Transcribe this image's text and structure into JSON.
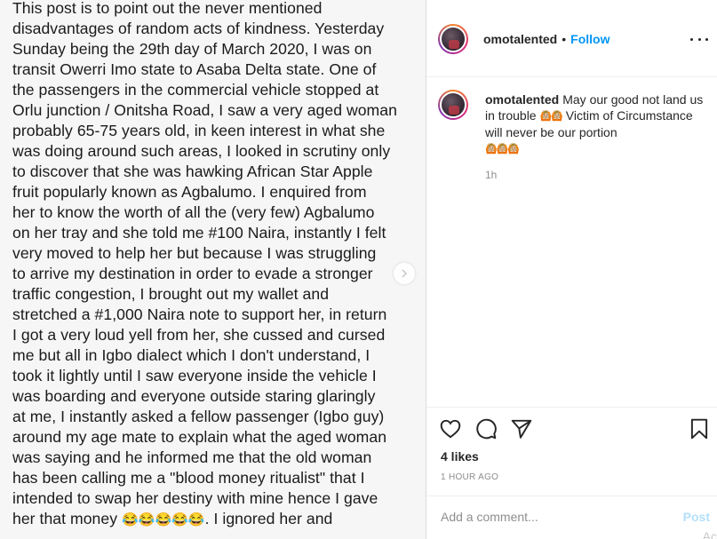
{
  "post": {
    "text_lines": [
      "This post is to point out the never mentioned",
      "disadvantages of random acts of kindness. Yesterday",
      "Sunday being the 29th day of March 2020, I was on",
      "transit Owerri Imo state to Asaba Delta state. One of",
      "the passengers in the commercial vehicle stopped at",
      "Orlu junction / Onitsha Road, I saw a very aged woman",
      "probably 65-75 years old, in keen interest in what she",
      "was doing around such areas, I looked in scrutiny only",
      "to discover that she was hawking African Star Apple",
      "fruit popularly known as Agbalumo. I enquired from",
      "her to know the worth of all the (very few) Agbalumo",
      "on her tray and she told me #100 Naira, instantly I felt",
      "very moved to help her but because I was struggling",
      "to arrive my destination in order to evade a stronger",
      "traffic congestion, I brought out my wallet and",
      "stretched a #1,000 Naira note to support her, in return",
      "I got a very loud yell from her, she cussed and cursed",
      "me but all in Igbo dialect which I don't understand, I",
      "took it lightly until I saw everyone inside the vehicle I",
      "was boarding and everyone outside staring glaringly",
      "at me, I instantly asked a fellow passenger (Igbo guy)",
      "around my age mate to explain what the aged woman",
      "was saying and he informed me that the old woman",
      "has been calling me a \"blood money ritualist\" that I",
      "intended to swap her destiny with mine hence I gave"
    ],
    "last_line_start": "her that money ",
    "last_line_emojis": "😂😂😂😂😂",
    "last_line_end": ". I ignored her and"
  },
  "header": {
    "username": "omotalented",
    "separator": "•",
    "follow_label": "Follow"
  },
  "comment": {
    "username": "omotalented",
    "text_part1": "May our good not land us in trouble ",
    "emoji_a": "🙆🏼🙆🏼",
    "text_part2": " Victim of Circumstance will never be our portion",
    "emoji_b": "🙆🏼🙆🏼🙆🏼",
    "time": "1h"
  },
  "actions": {
    "likes": "4 likes",
    "time_ago": "1 HOUR AGO"
  },
  "add_comment": {
    "placeholder": "Add a comment...",
    "post_label": "Post"
  },
  "edge_fragment": "Ac",
  "icons": {
    "like": "heart-icon",
    "comment": "comment-bubble-icon",
    "share": "paper-plane-icon",
    "save": "bookmark-icon",
    "more": "more-dots-icon",
    "next": "chevron-right-icon"
  },
  "colors": {
    "link_blue": "#0095f6",
    "post_disabled": "#b2dffc",
    "muted_text": "#8e8e8e"
  }
}
